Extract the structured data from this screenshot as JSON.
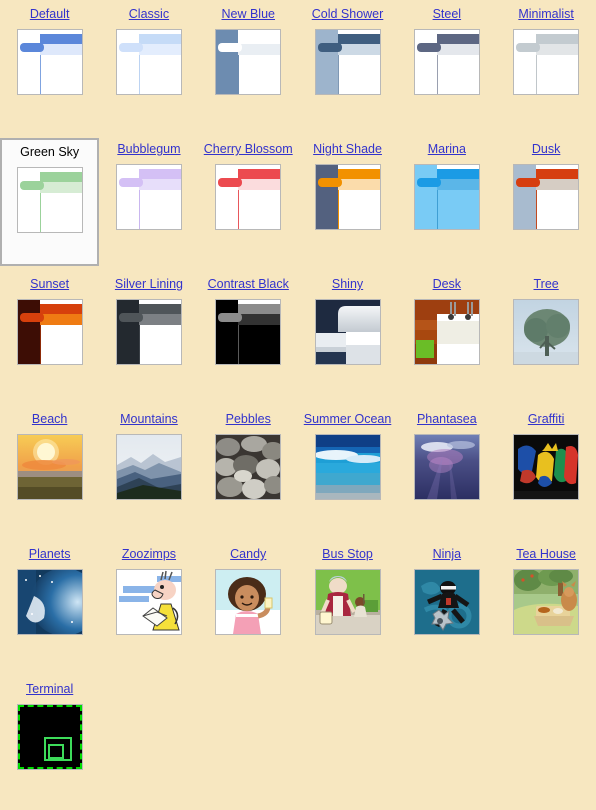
{
  "page": {
    "background_color": "#f7e7c0",
    "link_color": "#3333cc",
    "selected_theme": "Green Sky"
  },
  "themes": [
    {
      "name": "Default",
      "selected": false,
      "style": "chrome",
      "colors": {
        "side": "#ffffff",
        "head": "#5b87da",
        "tab": "#5b87da",
        "strip": "#dee8fb",
        "rule": "#7fa3e0",
        "body": "#ffffff"
      }
    },
    {
      "name": "Classic",
      "selected": false,
      "style": "chrome",
      "colors": {
        "side": "#ffffff",
        "head": "#c5dbf7",
        "tab": "#cfe0fa",
        "strip": "#e3edfd",
        "rule": "#bcd3f2",
        "body": "#ffffff"
      }
    },
    {
      "name": "New Blue",
      "selected": false,
      "style": "chrome",
      "colors": {
        "side": "#6d8cb0",
        "head": "#ffffff",
        "tab": "#ffffff",
        "strip": "#e9eef3",
        "rule": "#6d8cb0",
        "body": "#ffffff"
      }
    },
    {
      "name": "Cold Shower",
      "selected": false,
      "style": "chrome",
      "colors": {
        "side": "#9db4cc",
        "head": "#3f5e80",
        "tab": "#3f5e80",
        "strip": "#ccd9e5",
        "rule": "#7f98b4",
        "body": "#ffffff"
      }
    },
    {
      "name": "Steel",
      "selected": false,
      "style": "chrome",
      "colors": {
        "side": "#ffffff",
        "head": "#5d6783",
        "tab": "#5d6783",
        "strip": "#e4e7ec",
        "rule": "#9aa0b0",
        "body": "#ffffff"
      }
    },
    {
      "name": "Minimalist",
      "selected": false,
      "style": "chrome",
      "colors": {
        "side": "#ffffff",
        "head": "#c3cbd0",
        "tab": "#c3cbd0",
        "strip": "#e2e5e7",
        "rule": "#c0c6ca",
        "body": "#ffffff"
      }
    },
    {
      "name": "Green Sky",
      "selected": true,
      "style": "chrome",
      "colors": {
        "side": "#ffffff",
        "head": "#9bd29b",
        "tab": "#9bd29b",
        "strip": "#d6ecd4",
        "rule": "#9bd29b",
        "body": "#ffffff"
      }
    },
    {
      "name": "Bubblegum",
      "selected": false,
      "style": "chrome",
      "colors": {
        "side": "#ffffff",
        "head": "#d4c0f5",
        "tab": "#d4c0f5",
        "strip": "#e7defa",
        "rule": "#c9b6ef",
        "body": "#ffffff"
      }
    },
    {
      "name": "Cherry Blossom",
      "selected": false,
      "style": "chrome",
      "colors": {
        "side": "#ffffff",
        "head": "#ec4a4f",
        "tab": "#ec4a4f",
        "strip": "#fbdcdd",
        "rule": "#e8575c",
        "body": "#ffffff"
      }
    },
    {
      "name": "Night Shade",
      "selected": false,
      "style": "chrome",
      "colors": {
        "side": "#53617f",
        "head": "#f29100",
        "tab": "#f29100",
        "strip": "#fbdcab",
        "rule": "#f29100",
        "body": "#ffffff"
      }
    },
    {
      "name": "Marina",
      "selected": false,
      "style": "chrome",
      "colors": {
        "side": "#79cbf5",
        "head": "#1b9be5",
        "tab": "#1b9be5",
        "strip": "#5bb6e8",
        "rule": "#3f9fd4",
        "body": "#79cbf5"
      }
    },
    {
      "name": "Dusk",
      "selected": false,
      "style": "chrome",
      "colors": {
        "side": "#a8bbcf",
        "head": "#d63e10",
        "tab": "#d63e10",
        "strip": "#d6cdc4",
        "rule": "#c24a20",
        "body": "#ffffff"
      }
    },
    {
      "name": "Sunset",
      "selected": false,
      "style": "chrome",
      "colors": {
        "side": "#3d0d05",
        "head": "#d6400c",
        "tab": "#d6400c",
        "strip": "#ef7b13",
        "rule": "#8d2a08",
        "body": "#ffffff"
      }
    },
    {
      "name": "Silver Lining",
      "selected": false,
      "style": "chrome",
      "colors": {
        "side": "#23292f",
        "head": "#4f5559",
        "tab": "#4f5559",
        "strip": "#7c8084",
        "rule": "#3a4046",
        "body": "#ffffff"
      }
    },
    {
      "name": "Contrast Black",
      "selected": false,
      "style": "chrome",
      "colors": {
        "side": "#000000",
        "head": "#8c8c8c",
        "tab": "#8c8c8c",
        "strip": "#333333",
        "rule": "#5a5a5a",
        "body": "#000000"
      }
    },
    {
      "name": "Shiny",
      "selected": false,
      "style": "shiny",
      "colors": {}
    },
    {
      "name": "Desk",
      "selected": false,
      "style": "desk",
      "colors": {}
    },
    {
      "name": "Tree",
      "selected": false,
      "style": "tree",
      "colors": {}
    },
    {
      "name": "Beach",
      "selected": false,
      "style": "beach",
      "colors": {}
    },
    {
      "name": "Mountains",
      "selected": false,
      "style": "mountains",
      "colors": {}
    },
    {
      "name": "Pebbles",
      "selected": false,
      "style": "pebbles",
      "colors": {}
    },
    {
      "name": "Summer Ocean",
      "selected": false,
      "style": "ocean",
      "colors": {}
    },
    {
      "name": "Phantasea",
      "selected": false,
      "style": "phantasea",
      "colors": {}
    },
    {
      "name": "Graffiti",
      "selected": false,
      "style": "graffiti",
      "colors": {}
    },
    {
      "name": "Planets",
      "selected": false,
      "style": "planets",
      "colors": {}
    },
    {
      "name": "Zoozimps",
      "selected": false,
      "style": "zoozimps",
      "colors": {}
    },
    {
      "name": "Candy",
      "selected": false,
      "style": "candy",
      "colors": {}
    },
    {
      "name": "Bus Stop",
      "selected": false,
      "style": "busstop",
      "colors": {}
    },
    {
      "name": "Ninja",
      "selected": false,
      "style": "ninja",
      "colors": {}
    },
    {
      "name": "Tea House",
      "selected": false,
      "style": "teahouse",
      "colors": {}
    },
    {
      "name": "Terminal",
      "selected": false,
      "style": "terminal",
      "colors": {}
    }
  ]
}
